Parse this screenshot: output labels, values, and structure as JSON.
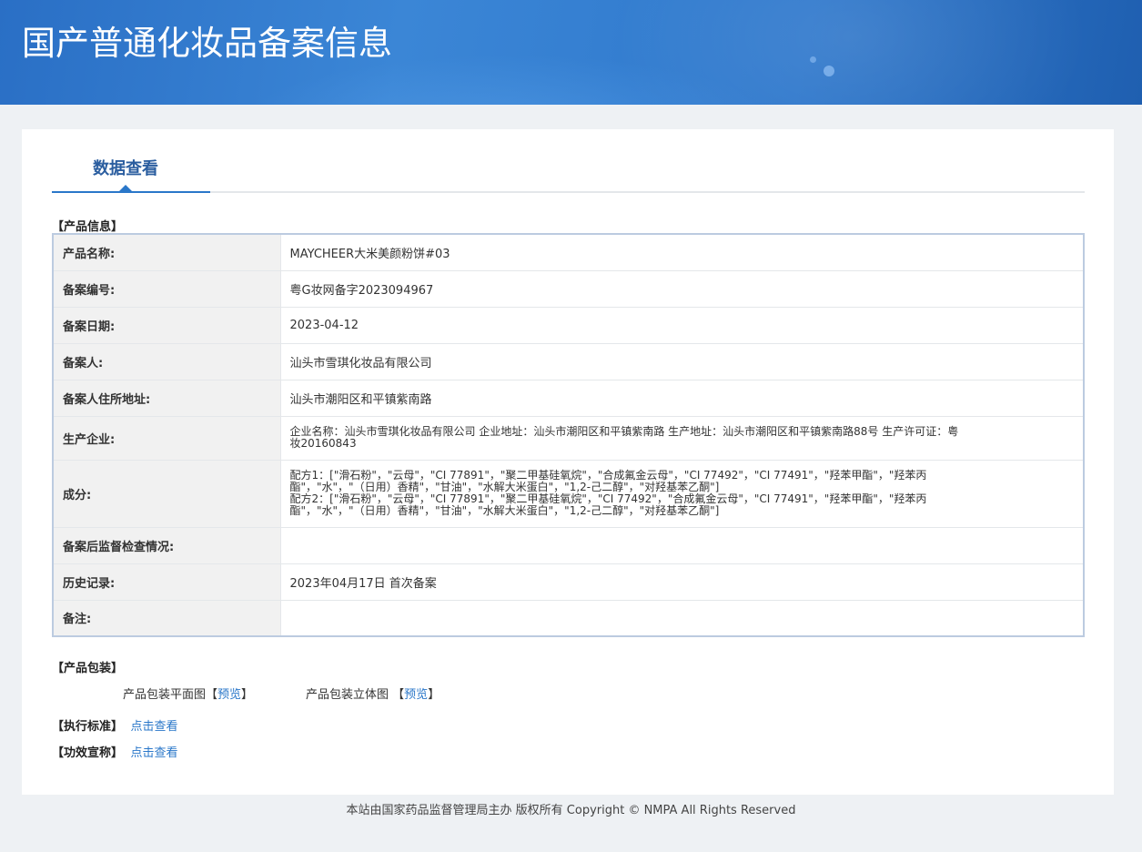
{
  "header": {
    "title": "国产普通化妆品备案信息"
  },
  "tabs": [
    {
      "label": "数据查看",
      "active": true
    }
  ],
  "product_info": {
    "section_label": "【产品信息】",
    "rows": [
      {
        "key": "产品名称:",
        "value": "MAYCHEER大米美颜粉饼#03"
      },
      {
        "key": "备案编号:",
        "value": "粤G妆网备字2023094967"
      },
      {
        "key": "备案日期:",
        "value": "2023-04-12"
      },
      {
        "key": "备案人:",
        "value": "汕头市雪琪化妆品有限公司"
      },
      {
        "key": "备案人住所地址:",
        "value": "汕头市潮阳区和平镇紫南路"
      },
      {
        "key": "生产企业:",
        "lines": [
          "企业名称：汕头市雪琪化妆品有限公司 企业地址：汕头市潮阳区和平镇紫南路 生产地址：汕头市潮阳区和平镇紫南路88号 生产许可证：粤",
          "妆20160843"
        ]
      },
      {
        "key": "成分:",
        "lines": [
          "配方1：[\"滑石粉\"，\"云母\"，\"CI 77891\"，\"聚二甲基硅氧烷\"，\"合成氟金云母\"，\"CI 77492\"，\"CI 77491\"，\"羟苯甲酯\"，\"羟苯丙",
          "酯\"，\"水\"，\"（日用）香精\"，\"甘油\"，\"水解大米蛋白\"，\"1,2-己二醇\"，\"对羟基苯乙酮\"]",
          "配方2：[\"滑石粉\"，\"云母\"，\"CI 77891\"，\"聚二甲基硅氧烷\"，\"CI 77492\"，\"合成氟金云母\"，\"CI 77491\"，\"羟苯甲酯\"，\"羟苯丙",
          "酯\"，\"水\"，\"（日用）香精\"，\"甘油\"，\"水解大米蛋白\"，\"1,2-己二醇\"，\"对羟基苯乙酮\"]"
        ]
      },
      {
        "key": "备案后监督检查情况:",
        "value": ""
      },
      {
        "key": "历史记录:",
        "value": "2023年04月17日 首次备案"
      },
      {
        "key": "备注:",
        "value": ""
      }
    ]
  },
  "packaging": {
    "section_label": "【产品包装】",
    "flat_label": "产品包装平面图",
    "flat_link_open": "【",
    "flat_link": "预览",
    "flat_link_close": "】",
    "solid_label": "产品包装立体图",
    "solid_link_open": "【",
    "solid_link": "预览",
    "solid_link_close": "】"
  },
  "standard": {
    "label": "【执行标准】",
    "link": "点击查看"
  },
  "efficacy": {
    "label": "【功效宣称】",
    "link": "点击查看"
  },
  "footer": {
    "text": "本站由国家药品监督管理局主办 版权所有 Copyright © NMPA All Rights Reserved"
  }
}
